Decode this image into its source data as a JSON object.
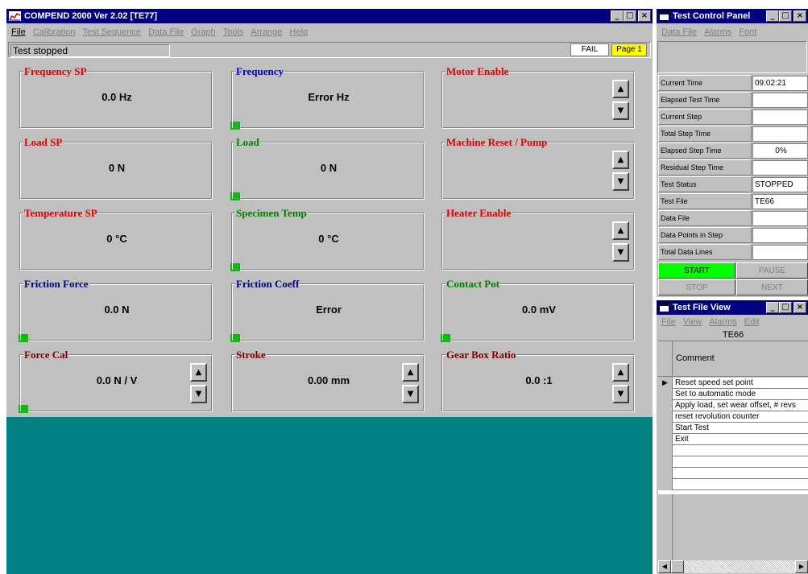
{
  "main_window": {
    "title": "COMPEND 2000 Ver 2.02  [TE77]",
    "menu": [
      "File",
      "Calibration",
      "Test Sequence",
      "Data File",
      "Graph",
      "Tools",
      "Arrange",
      "Help"
    ],
    "status_text": "Test stopped",
    "fail_label": "FAIL",
    "page_label": "Page 1"
  },
  "panels": [
    {
      "title": "Frequency SP",
      "value": "0.0 Hz",
      "title_color": "#e00000",
      "indicator": false,
      "spinner": false
    },
    {
      "title": "Frequency",
      "value": "Error Hz",
      "title_color": "#0000c0",
      "indicator": true,
      "spinner": false
    },
    {
      "title": "Motor Enable",
      "value": "",
      "title_color": "#e00000",
      "indicator": false,
      "spinner": true
    },
    {
      "title": "Load SP",
      "value": "0 N",
      "title_color": "#e00000",
      "indicator": false,
      "spinner": false
    },
    {
      "title": "Load",
      "value": "0 N",
      "title_color": "#008000",
      "indicator": true,
      "spinner": false
    },
    {
      "title": "Machine Reset / Pump",
      "value": "",
      "title_color": "#e00000",
      "indicator": false,
      "spinner": true
    },
    {
      "title": "Temperature SP",
      "value": "0 °C",
      "title_color": "#e00000",
      "indicator": false,
      "spinner": false
    },
    {
      "title": "Specimen Temp",
      "value": "0 °C",
      "title_color": "#008000",
      "indicator": true,
      "spinner": false
    },
    {
      "title": "Heater Enable",
      "value": "",
      "title_color": "#e00000",
      "indicator": false,
      "spinner": true
    },
    {
      "title": "Friction Force",
      "value": "0.0 N",
      "title_color": "#000080",
      "indicator": true,
      "spinner": false
    },
    {
      "title": "Friction Coeff",
      "value": "Error",
      "title_color": "#000080",
      "indicator": true,
      "spinner": false
    },
    {
      "title": "Contact Pot",
      "value": "0.0 mV",
      "title_color": "#008000",
      "indicator": true,
      "spinner": false
    },
    {
      "title": "Force Cal",
      "value": "0.0 N / V",
      "title_color": "#800000",
      "indicator": true,
      "spinner": true
    },
    {
      "title": "Stroke",
      "value": "0.00 mm",
      "title_color": "#800000",
      "indicator": false,
      "spinner": true
    },
    {
      "title": "Gear Box Ratio",
      "value": "0.0 :1",
      "title_color": "#800000",
      "indicator": false,
      "spinner": true
    }
  ],
  "control_panel": {
    "title": "Test Control Panel",
    "menu": [
      "Data File",
      "Alarms",
      "Font"
    ],
    "rows": [
      {
        "label": "Current Time",
        "value": "09:02:21"
      },
      {
        "label": "Elapsed Test Time",
        "value": ""
      },
      {
        "label": "Current Step",
        "value": ""
      },
      {
        "label": "Total Step Time",
        "value": ""
      },
      {
        "label": "Elapsed Step Time",
        "value": "0%"
      },
      {
        "label": "Residual Step Time",
        "value": ""
      },
      {
        "label": "Test Status",
        "value": "STOPPED"
      },
      {
        "label": "Test File",
        "value": "TE66"
      },
      {
        "label": "Data File",
        "value": ""
      },
      {
        "label": "Data Points in Step",
        "value": ""
      },
      {
        "label": "Total Data Lines",
        "value": ""
      }
    ],
    "buttons": {
      "start": "START",
      "pause": "PAUSE",
      "stop": "STOP",
      "next": "NEXT"
    },
    "start_color": "#00ff00"
  },
  "file_view": {
    "title": "Test File View",
    "menu": [
      "File",
      "View",
      "Alarms",
      "Edit"
    ],
    "file_name": "TE66",
    "column_header": "Comment",
    "rows": [
      "Reset speed set point",
      "Set to automatic mode",
      "Apply load, set wear offset, # revs",
      "reset revolution counter",
      "Start Test",
      "Exit",
      "",
      "",
      "",
      ""
    ]
  },
  "desktop_color": "#008080",
  "titlebar_color": "#000080"
}
